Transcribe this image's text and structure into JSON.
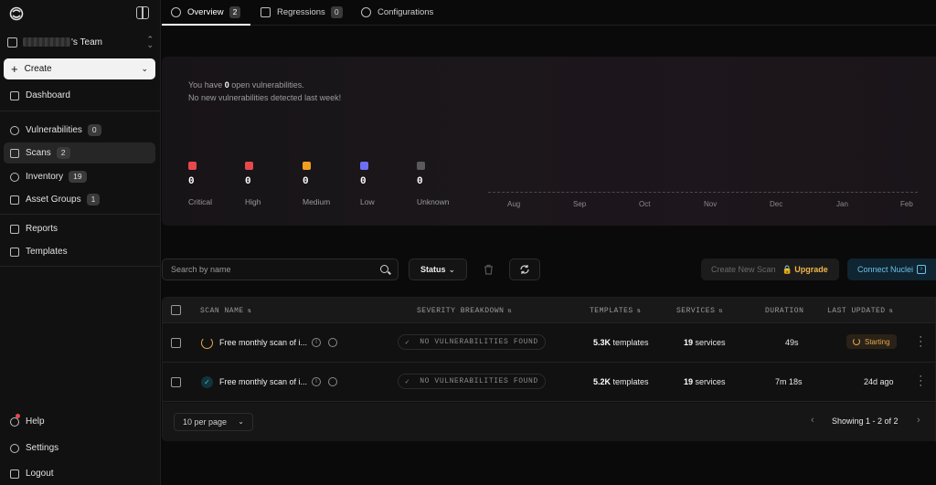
{
  "sidebar": {
    "team_name": "'s Team",
    "create_label": "Create",
    "items": [
      {
        "label": "Dashboard"
      },
      {
        "label": "Vulnerabilities",
        "count": "0"
      },
      {
        "label": "Scans",
        "count": "2"
      },
      {
        "label": "Inventory",
        "count": "19"
      },
      {
        "label": "Asset Groups",
        "count": "1"
      },
      {
        "label": "Reports"
      },
      {
        "label": "Templates"
      }
    ],
    "bottom": [
      {
        "label": "Help"
      },
      {
        "label": "Settings"
      },
      {
        "label": "Logout"
      }
    ]
  },
  "tabs": [
    {
      "label": "Overview",
      "count": "2"
    },
    {
      "label": "Regressions",
      "count": "0"
    },
    {
      "label": "Configurations"
    }
  ],
  "summary": {
    "line1_prefix": "You have ",
    "open_count": "0",
    "line1_suffix": " open vulnerabilities.",
    "line2": "No new vulnerabilities detected last week!",
    "severities": [
      {
        "label": "Critical",
        "value": "0",
        "color": "#e5484d"
      },
      {
        "label": "High",
        "value": "0",
        "color": "#e5484d"
      },
      {
        "label": "Medium",
        "value": "0",
        "color": "#f0a020"
      },
      {
        "label": "Low",
        "value": "0",
        "color": "#6e6ef2"
      },
      {
        "label": "Unknown",
        "value": "0",
        "color": "#5a5a5a"
      }
    ],
    "months": [
      "Aug",
      "Sep",
      "Oct",
      "Nov",
      "Dec",
      "Jan",
      "Feb"
    ]
  },
  "toolbar": {
    "search_placeholder": "Search by name",
    "status_label": "Status",
    "new_scan_label": "Create New Scan",
    "upgrade_label": "Upgrade",
    "connect_label": "Connect Nuclei"
  },
  "table": {
    "columns": {
      "scan_name": "SCAN NAME",
      "severity": "SEVERITY BREAKDOWN",
      "templates": "TEMPLATES",
      "services": "SERVICES",
      "duration": "DURATION",
      "last_updated": "LAST UPDATED"
    },
    "rows": [
      {
        "name": "Free monthly scan of i...",
        "severity": "NO VULNERABILITIES FOUND",
        "templates": "5.3K",
        "templates_suffix": " templates",
        "services": "19",
        "services_suffix": " services",
        "duration": "49s",
        "last_updated": "Starting",
        "status": "running"
      },
      {
        "name": "Free monthly scan of i...",
        "severity": "NO VULNERABILITIES FOUND",
        "templates": "5.2K",
        "templates_suffix": " templates",
        "services": "19",
        "services_suffix": " services",
        "duration": "7m 18s",
        "last_updated": "24d ago",
        "status": "done"
      }
    ],
    "per_page": "10 per page",
    "pagination": "Showing 1 - 2 of 2"
  }
}
